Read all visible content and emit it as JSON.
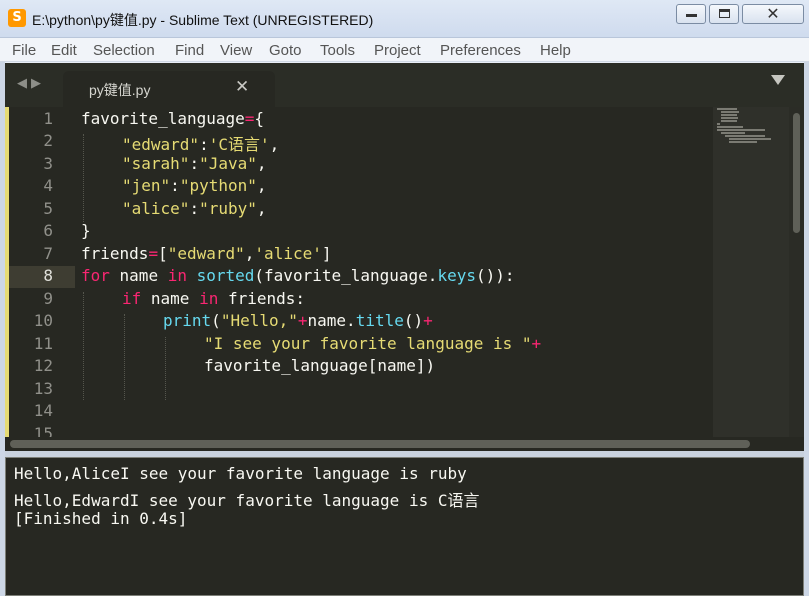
{
  "window": {
    "title": "E:\\python\\py键值.py - Sublime Text (UNREGISTERED)",
    "app_icon_glyph": "S",
    "close_glyph": "✕"
  },
  "menu": [
    "File",
    "Edit",
    "Selection",
    "Find",
    "View",
    "Goto",
    "Tools",
    "Project",
    "Preferences",
    "Help"
  ],
  "tabs": {
    "nav_glyphs": "◀▶",
    "active": {
      "label": "py键值.py",
      "close_glyph": "✕"
    }
  },
  "editor": {
    "current_line": 8,
    "line_numbers": [
      "1",
      "2",
      "3",
      "4",
      "5",
      "6",
      "7",
      "8",
      "9",
      "10",
      "11",
      "12",
      "13",
      "14",
      "15"
    ],
    "code": {
      "l1": {
        "a": "favorite_language",
        "op": "=",
        "b": "{"
      },
      "l2": {
        "s1": "\"edward\"",
        "c": ":",
        "s2": "'C语言'",
        "t": ","
      },
      "l3": {
        "s1": "\"sarah\"",
        "c": ":",
        "s2": "\"Java\"",
        "t": ","
      },
      "l4": {
        "s1": "\"jen\"",
        "c": ":",
        "s2": "\"python\"",
        "t": ","
      },
      "l5": {
        "s1": "\"alice\"",
        "c": ":",
        "s2": "\"ruby\"",
        "t": ","
      },
      "l6": {
        "a": "}"
      },
      "l7": {
        "a": "friends",
        "op": "=",
        "b": "[",
        "s1": "\"edward\"",
        "c": ",",
        "s2": "'alice'",
        "e": "]"
      },
      "l8": {
        "k1": "for",
        "a": " name ",
        "k2": "in",
        "sp": " ",
        "f1": "sorted",
        "b": "(favorite_language.",
        "f2": "keys",
        "e": "()):"
      },
      "l9": {
        "k1": "if",
        "a": " name ",
        "k2": "in",
        "b": " friends:"
      },
      "l10": {
        "f1": "print",
        "b": "(",
        "s1": "\"Hello,\"",
        "op1": "+",
        "c": "name.",
        "f2": "title",
        "d": "()",
        "op2": "+"
      },
      "l11": {
        "s1": "\"I see your favorite language is \"",
        "op": "+"
      },
      "l12": {
        "a": "favorite_language[name])"
      }
    }
  },
  "output": {
    "lines": [
      "Hello,AliceI see your favorite language is ruby",
      "Hello,EdwardI see your favorite language is C语言",
      "[Finished in 0.4s]"
    ]
  },
  "colors": {
    "background": "#272822",
    "string": "#e6db74",
    "keyword": "#f92672",
    "function": "#66d9ef",
    "text": "#f8f8f2"
  }
}
